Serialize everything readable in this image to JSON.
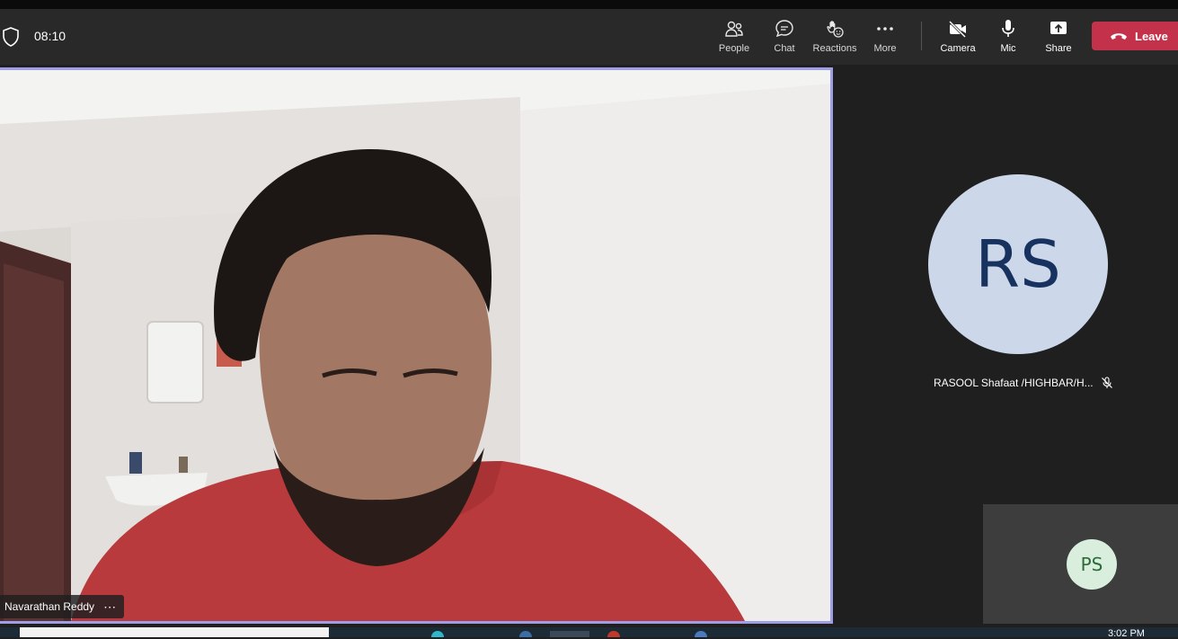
{
  "meeting": {
    "timer": "08:10"
  },
  "toolbar": {
    "people_label": "People",
    "chat_label": "Chat",
    "reactions_label": "Reactions",
    "more_label": "More",
    "camera_label": "Camera",
    "mic_label": "Mic",
    "share_label": "Share",
    "leave_label": "Leave",
    "leave_color": "#c4314b"
  },
  "main_participant": {
    "name": "Navarathan Reddy",
    "more_dots": "⋯",
    "highlight_color": "#9d9ee6"
  },
  "participants": [
    {
      "initials": "RS",
      "display_name": "RASOOL Shafaat /HIGHBAR/H...",
      "muted": true,
      "avatar_color": "#ccd8ea"
    },
    {
      "initials": "PS",
      "avatar_color": "#d9eedd"
    }
  ],
  "taskbar": {
    "clock": "3:02 PM"
  }
}
